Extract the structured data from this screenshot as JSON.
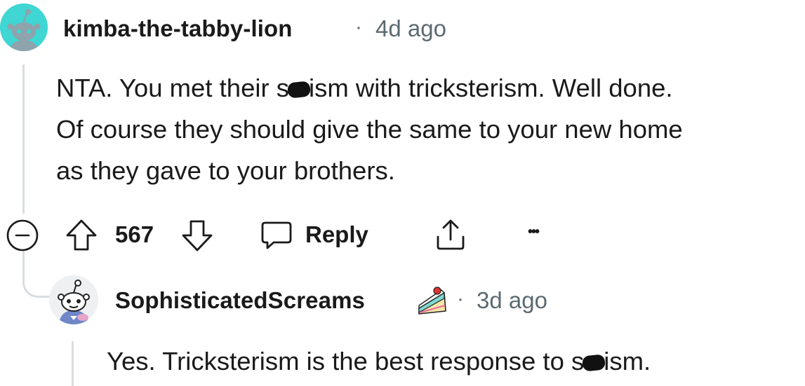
{
  "comment": {
    "author": "kimba-the-tabby-lion",
    "age": "4d ago",
    "body_lines": [
      {
        "before": "NTA. You met their s",
        "after": "ism with tricksterism. Well done."
      },
      {
        "text": "Of course they should give the same to your new home"
      },
      {
        "text": "as they gave to your brothers."
      }
    ],
    "actions": {
      "score": "567",
      "reply_label": "Reply",
      "more_label": "•••"
    }
  },
  "reply": {
    "author": "SophisticatedScreams",
    "age": "3d ago",
    "body": {
      "before": "Yes. Tricksterism is the best response to s",
      "after": "ism."
    }
  },
  "icons": {
    "collapse": "collapse-minus-icon",
    "upvote": "upvote-arrow-icon",
    "downvote": "downvote-arrow-icon",
    "reply": "speech-bubble-icon",
    "share": "share-icon",
    "more": "more-dots-icon",
    "award": "cake-icon"
  },
  "colors": {
    "avatar1_bg": "#3fd6d3",
    "meta_text": "#5c6a72",
    "thread_line": "#d9dde0"
  }
}
